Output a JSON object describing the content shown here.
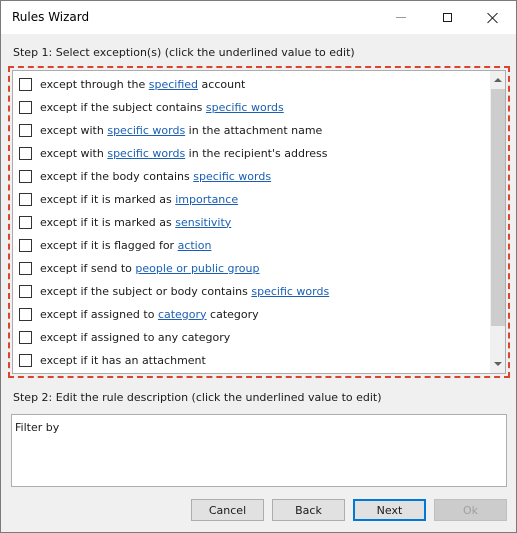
{
  "window": {
    "title": "Rules Wizard"
  },
  "step1": {
    "label": "Step 1: Select exception(s) (click the underlined value to edit)"
  },
  "exceptions": [
    {
      "before": "except through the ",
      "link": "specified",
      "after": " account"
    },
    {
      "before": "except if the subject contains ",
      "link": "specific words",
      "after": ""
    },
    {
      "before": "except with ",
      "link": "specific words",
      "after": " in the attachment name"
    },
    {
      "before": "except with ",
      "link": "specific words",
      "after": " in the recipient's address"
    },
    {
      "before": "except if the body contains ",
      "link": "specific words",
      "after": ""
    },
    {
      "before": "except if it is marked as ",
      "link": "importance",
      "after": ""
    },
    {
      "before": "except if it is marked as ",
      "link": "sensitivity",
      "after": ""
    },
    {
      "before": "except if it is flagged for ",
      "link": "action",
      "after": ""
    },
    {
      "before": "except if send to ",
      "link": "people or public group",
      "after": ""
    },
    {
      "before": "except if the subject or body contains ",
      "link": "specific words",
      "after": ""
    },
    {
      "before": "except if assigned to ",
      "link": "category",
      "after": " category"
    },
    {
      "before": "except if assigned to any category",
      "link": "",
      "after": ""
    },
    {
      "before": "except if it has an attachment",
      "link": "",
      "after": ""
    }
  ],
  "step2": {
    "label": "Step 2: Edit the rule description (click the underlined value to edit)",
    "description": "Filter by"
  },
  "buttons": {
    "cancel": "Cancel",
    "back": "Back",
    "next": "Next",
    "ok": "Ok"
  },
  "colors": {
    "link": "#1a5fb4",
    "highlight_border": "#d9452f",
    "default_button_border": "#0078d7"
  }
}
